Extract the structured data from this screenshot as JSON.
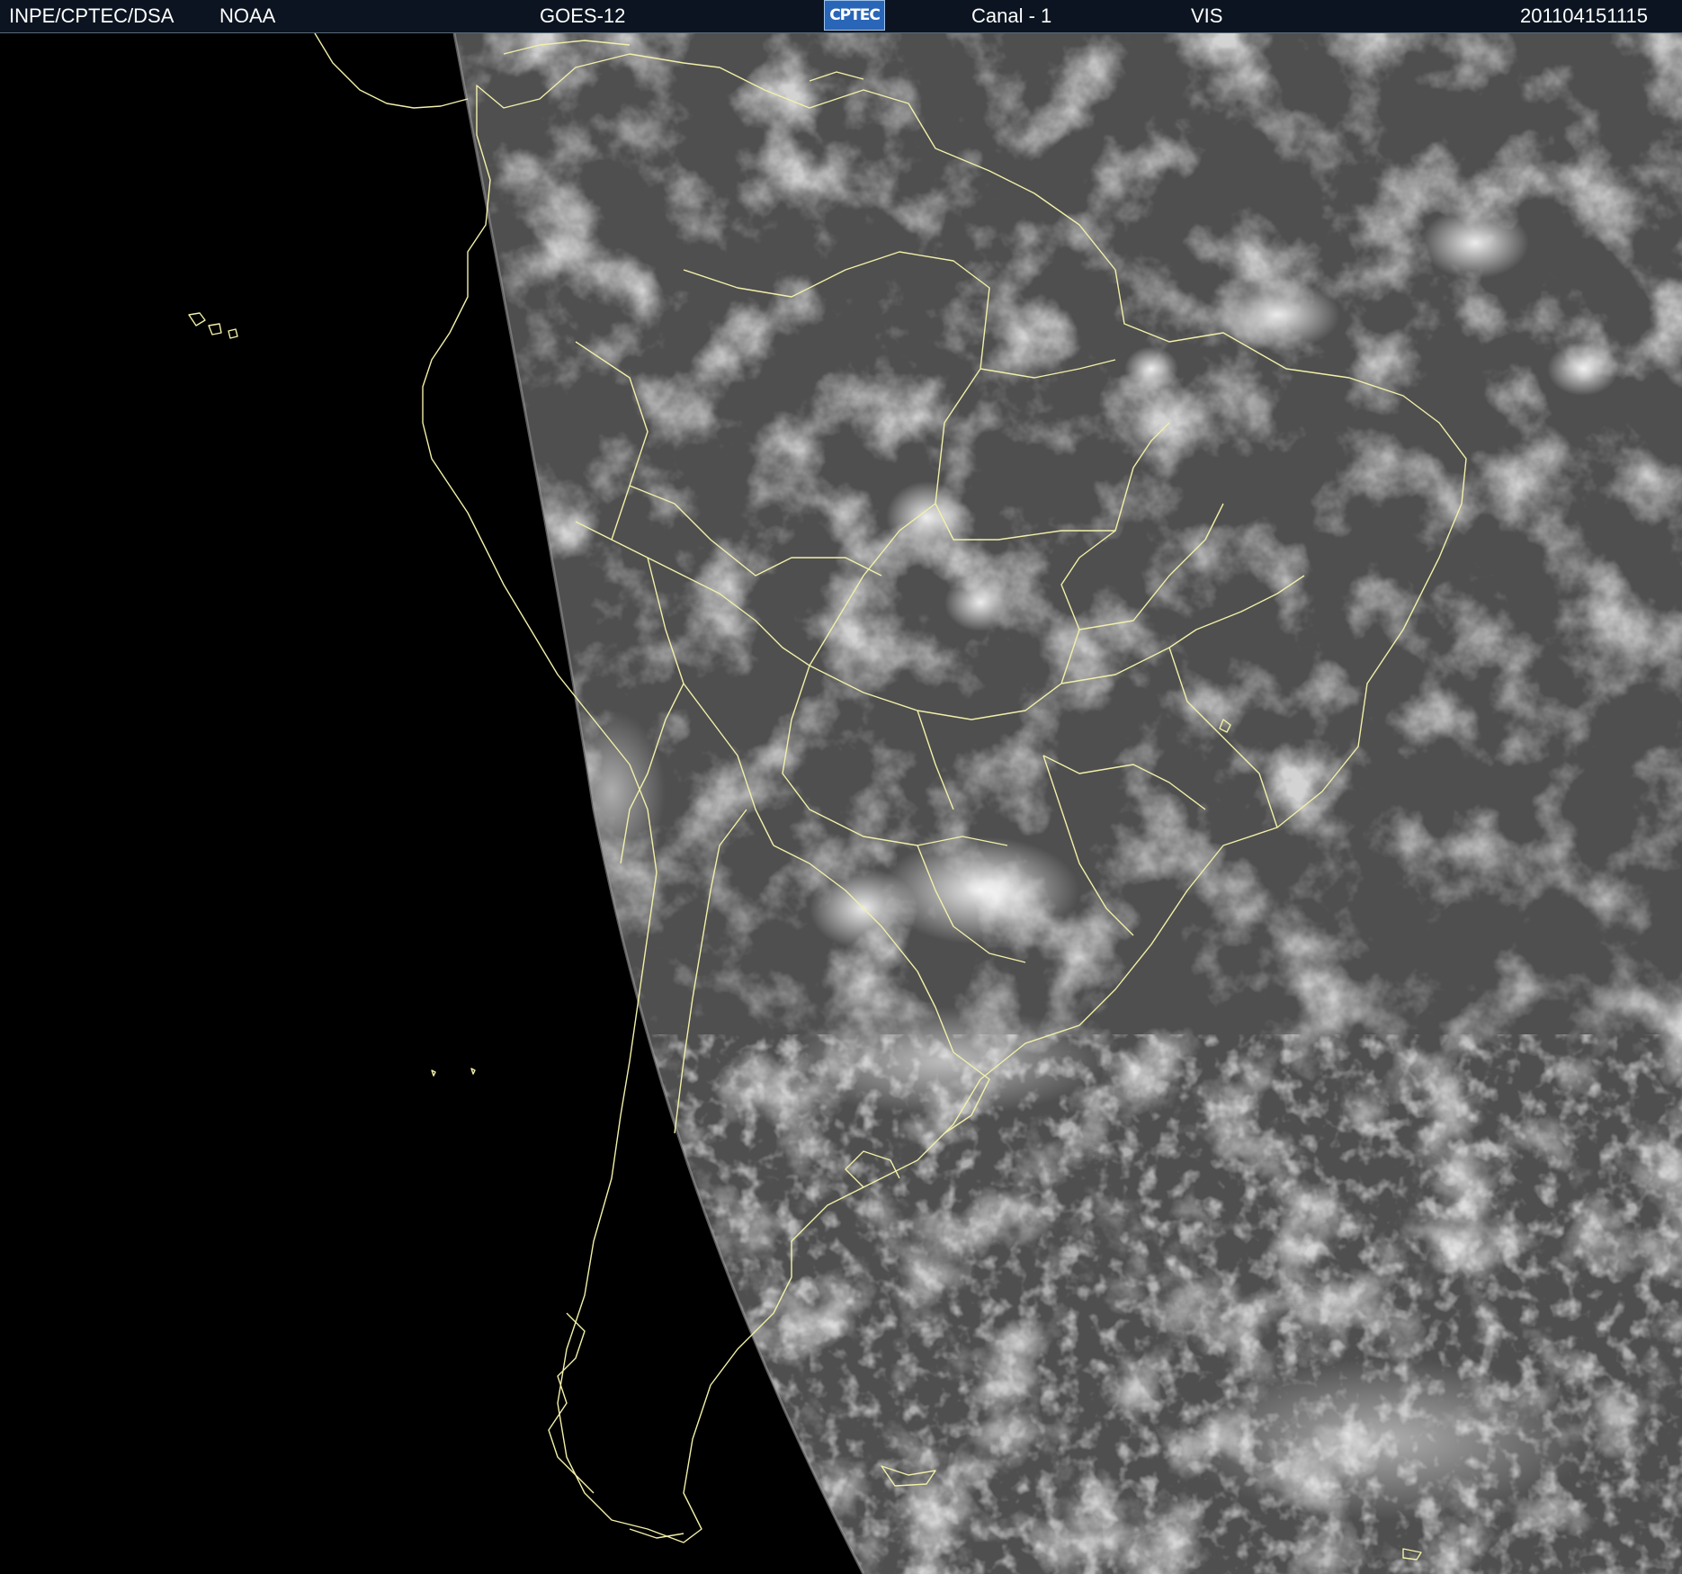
{
  "header": {
    "source": "INPE/CPTEC/DSA",
    "agency": "NOAA",
    "satellite": "GOES-12",
    "logo_text": "CPTEC",
    "channel": "Canal - 1",
    "band": "VIS",
    "timestamp": "201104151115"
  },
  "colors": {
    "header_bg": "#0b1420",
    "space": "#000000",
    "earth_base": "#4f4f4f",
    "cloud": "#e6e6e6",
    "coastline": "#f2f0a8"
  },
  "icons": {
    "logo": "cptec-logo"
  }
}
